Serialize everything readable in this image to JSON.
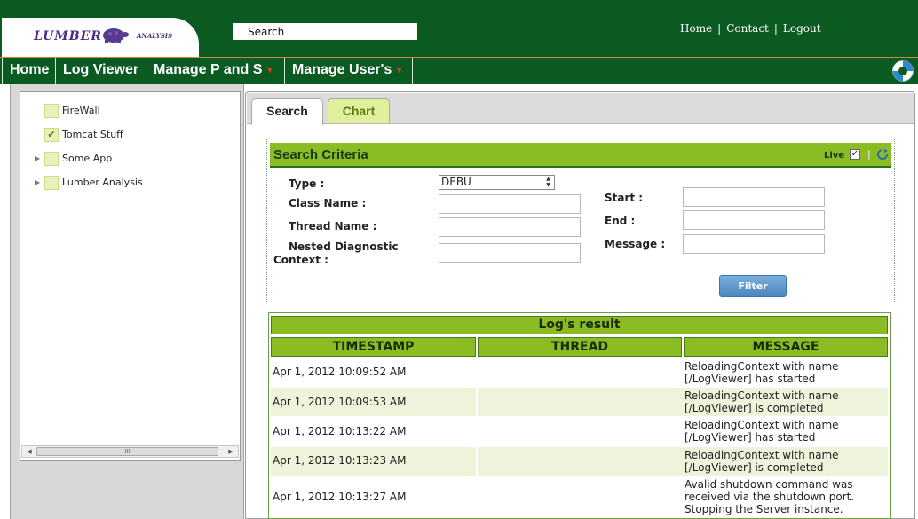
{
  "header": {
    "logo_text": "LUMBER",
    "logo_sub": "ANALYSIS",
    "search_value": "Search",
    "links": [
      "Home",
      "Contact",
      "Logout"
    ]
  },
  "nav": {
    "items": [
      {
        "label": "Home"
      },
      {
        "label": "Log Viewer"
      },
      {
        "label": "Manage P and S"
      },
      {
        "label": "Manage User's"
      }
    ]
  },
  "tree": {
    "items": [
      {
        "label": "FireWall",
        "checked": false,
        "expandable": false
      },
      {
        "label": "Tomcat Stuff",
        "checked": true,
        "expandable": false
      },
      {
        "label": "Some App",
        "checked": false,
        "expandable": true
      },
      {
        "label": "Lumber Analysis",
        "checked": false,
        "expandable": true
      }
    ],
    "scroll_thumb": "III"
  },
  "tabs": [
    {
      "label": "Search",
      "active": true
    },
    {
      "label": "Chart",
      "active": false
    }
  ],
  "criteria": {
    "title": "Search Criteria",
    "live_label": "Live",
    "live_checked": true,
    "type_label": "Type :",
    "type_value": "DEBU",
    "class_name_label": "Class Name :",
    "thread_name_label": "Thread Name :",
    "ndc_label_1": "Nested Diagnostic",
    "ndc_label_2": "Context :",
    "start_label": "Start :",
    "end_label": "End :",
    "message_label": "Message :",
    "filter_button": "Filter"
  },
  "results": {
    "title": "Log's result",
    "columns": [
      "TIMESTAMP",
      "THREAD",
      "MESSAGE"
    ],
    "rows": [
      {
        "timestamp": "Apr 1, 2012 10:09:52 AM",
        "thread": "",
        "message": "ReloadingContext with name [/LogViewer] has started"
      },
      {
        "timestamp": "Apr 1, 2012 10:09:53 AM",
        "thread": "",
        "message": "ReloadingContext with name [/LogViewer] is completed"
      },
      {
        "timestamp": "Apr 1, 2012 10:13:22 AM",
        "thread": "",
        "message": "ReloadingContext with name [/LogViewer] has started"
      },
      {
        "timestamp": "Apr 1, 2012 10:13:23 AM",
        "thread": "",
        "message": "ReloadingContext with name [/LogViewer] is completed"
      },
      {
        "timestamp": "Apr 1, 2012 10:13:27 AM",
        "thread": "",
        "message": "Avalid shutdown command was received via the shutdown port. Stopping the Server instance."
      }
    ]
  },
  "colors": {
    "header_green": "#0b5a22",
    "accent_lime": "#8cbc24",
    "row_alt": "#eef4dc",
    "button_blue": "#4c86c0"
  }
}
